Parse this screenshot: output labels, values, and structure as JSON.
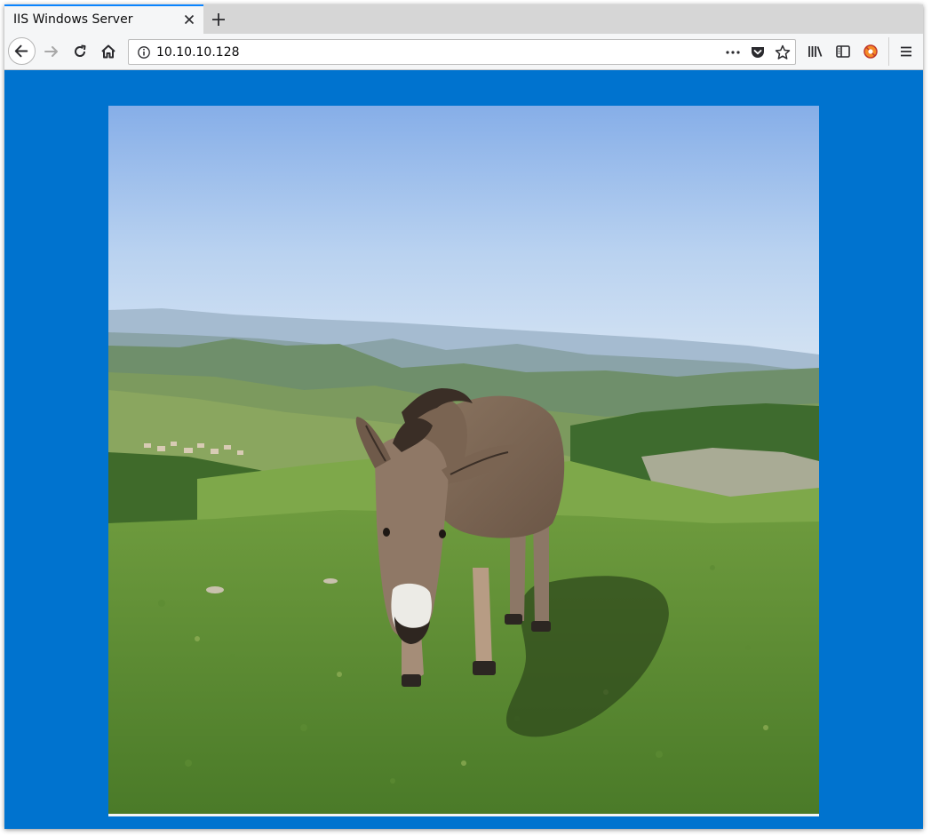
{
  "browser": {
    "tab": {
      "title": "IIS Windows Server"
    },
    "url": "10.10.10.128",
    "icons": {
      "close": "close-icon",
      "new_tab": "plus-icon",
      "back": "arrow-left-icon",
      "forward": "arrow-right-icon",
      "reload": "reload-icon",
      "home": "home-icon",
      "site_info": "info-icon",
      "page_actions": "ellipsis-icon",
      "pocket": "pocket-icon",
      "bookmark": "star-icon",
      "library": "library-icon",
      "sidebar": "sidebar-icon",
      "extension": "extension-icon",
      "menu": "hamburger-icon"
    }
  },
  "page": {
    "background_color": "#0073cf",
    "image": {
      "subject": "donkey-on-grassy-hilltop"
    }
  }
}
